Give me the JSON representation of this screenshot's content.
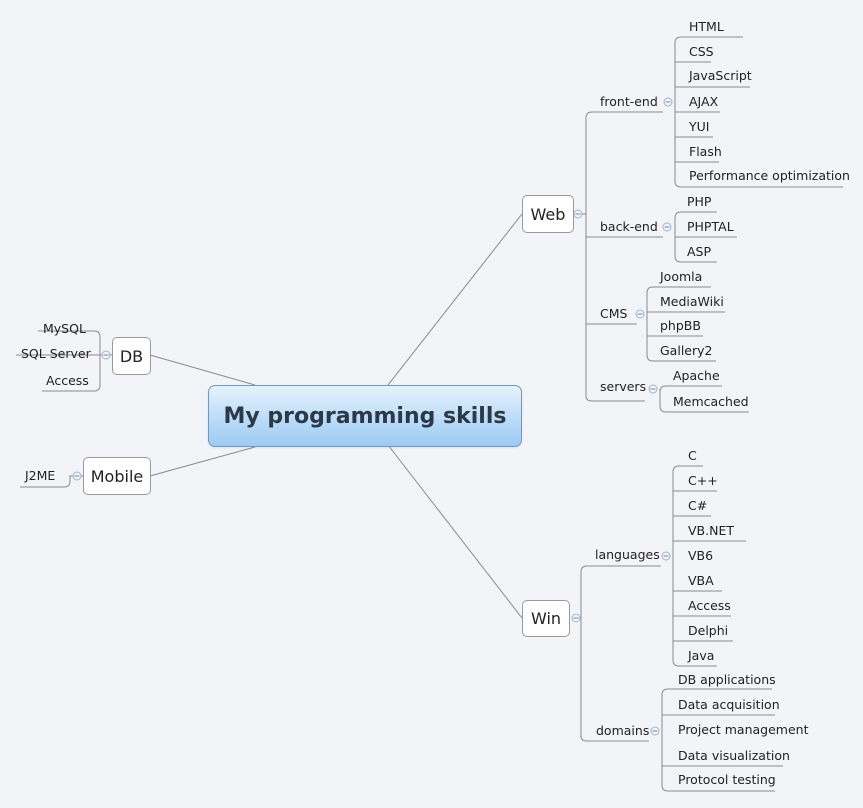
{
  "central": "My programming skills",
  "web": {
    "label": "Web",
    "front_end": {
      "label": "front-end",
      "items": [
        "HTML",
        "CSS",
        "JavaScript",
        "AJAX",
        "YUI",
        "Flash",
        "Performance optimization"
      ]
    },
    "back_end": {
      "label": "back-end",
      "items": [
        "PHP",
        "PHPTAL",
        "ASP"
      ]
    },
    "cms": {
      "label": "CMS",
      "items": [
        "Joomla",
        "MediaWiki",
        "phpBB",
        "Gallery2"
      ]
    },
    "servers": {
      "label": "servers",
      "items": [
        "Apache",
        "Memcached"
      ]
    }
  },
  "win": {
    "label": "Win",
    "languages": {
      "label": "languages",
      "items": [
        "C",
        "C++",
        "C#",
        "VB.NET",
        "VB6",
        "VBA",
        "Access",
        "Delphi",
        "Java"
      ]
    },
    "domains": {
      "label": "domains",
      "items": [
        "DB applications",
        "Data acquisition",
        "Project management",
        "Data visualization",
        "Protocol testing"
      ]
    }
  },
  "db": {
    "label": "DB",
    "items": [
      "MySQL",
      "SQL Server",
      "Access"
    ]
  },
  "mobile": {
    "label": "Mobile",
    "items": [
      "J2ME"
    ]
  }
}
